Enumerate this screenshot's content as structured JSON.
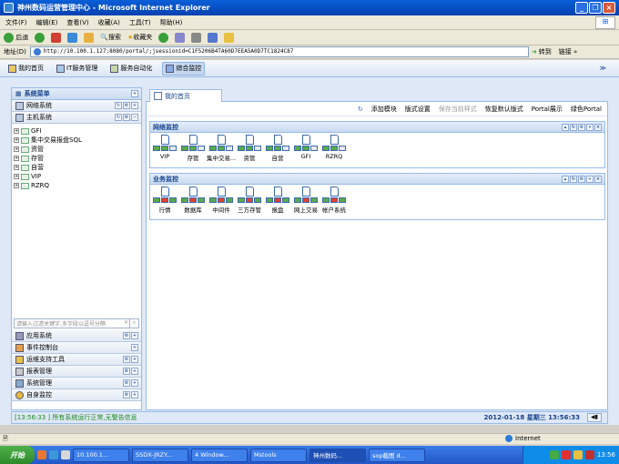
{
  "window": {
    "title": "神州数码运营管理中心 - Microsoft Internet Explorer",
    "buttons": [
      "_",
      "❐",
      "×"
    ]
  },
  "menu": [
    "文件(F)",
    "编辑(E)",
    "查看(V)",
    "收藏(A)",
    "工具(T)",
    "帮助(H)"
  ],
  "toolbar": {
    "back": "后退",
    "search": "搜索",
    "favorites": "收藏夹"
  },
  "address": {
    "label": "地址(D)",
    "url": "http://10.100.1.127:8080/portal/;jsessionid=C1F5206B4TA60D7EEA5A0D7TC1824C87",
    "go": "转到",
    "links": "链接 »"
  },
  "app_tabs": [
    {
      "label": "我的首页",
      "icon": "home-icon"
    },
    {
      "label": "IT服务管理",
      "icon": "it-service-icon"
    },
    {
      "label": "服务自动化",
      "icon": "automation-icon"
    },
    {
      "label": "综合监控",
      "icon": "monitor-icon",
      "active": true
    }
  ],
  "left_panel": {
    "title": "系统菜单",
    "groups_top": [
      {
        "label": "网络系统"
      },
      {
        "label": "主机系统"
      }
    ],
    "tree": [
      "GFI",
      "集中交易报盘SQL",
      "资管",
      "存管",
      "自营",
      "VIP",
      "RZRQ"
    ],
    "search_placeholder": "请输入过滤关键字,多字段以逗号分隔",
    "groups_bottom": [
      {
        "label": "应用系统"
      },
      {
        "label": "事件控制台"
      },
      {
        "label": "运维支持工具"
      },
      {
        "label": "报表管理"
      },
      {
        "label": "系统管理"
      },
      {
        "label": "自身监控"
      }
    ]
  },
  "main": {
    "tab_label": "我的首页",
    "actions": [
      {
        "label": "添加模块",
        "enabled": true
      },
      {
        "label": "版式设置",
        "enabled": true
      },
      {
        "label": "保存当前样式",
        "enabled": false
      },
      {
        "label": "恢复默认版式",
        "enabled": true
      },
      {
        "label": "Portal展示",
        "enabled": true
      },
      {
        "label": "绿色Portal",
        "enabled": true
      }
    ],
    "portlets": [
      {
        "title": "网络监控",
        "items": [
          "VIP",
          "存管",
          "集中交易...",
          "资管",
          "自营",
          "GFI",
          "RZRQ"
        ]
      },
      {
        "title": "业务监控",
        "items": [
          "行情",
          "数据库",
          "中间件",
          "三方存管",
          "报盘",
          "网上交易",
          "帐户系统"
        ]
      }
    ]
  },
  "status": {
    "message": "[13:56:33 ] 所有系统运行正常,无警告信息",
    "datetime": "2012-01-18 星期三 13:56:33"
  },
  "ie_status": {
    "zone": "Internet"
  },
  "taskbar": {
    "start": "开始",
    "tasks": [
      "10.100.1...",
      "SSDX-JRZY...",
      "4 Window...",
      "Mstools",
      "神州数码...",
      "sop截图 d..."
    ],
    "clock": "13:56"
  },
  "colors": {
    "accent": "#15428b",
    "border": "#99bbe8",
    "status_ok": "#1e8a1e",
    "xp_blue": "#0a5fd8"
  }
}
